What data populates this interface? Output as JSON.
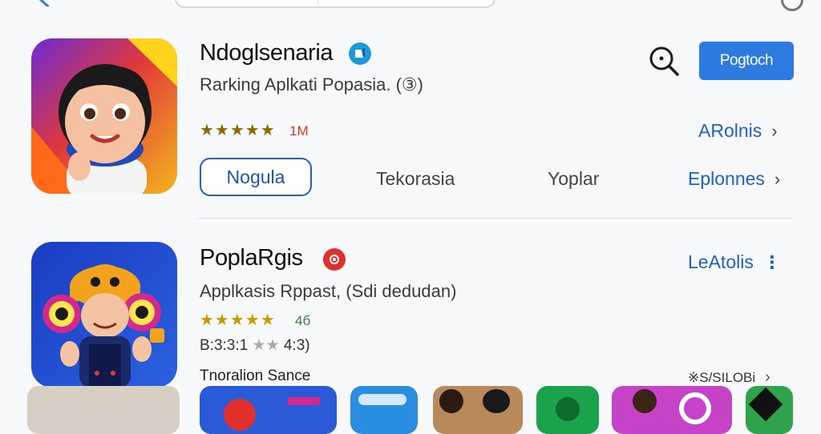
{
  "top_bar": {
    "back_icon": "chevron-left-icon",
    "search_icon": "search-icon"
  },
  "app1": {
    "title": "Ndoglsenaria",
    "subtitle": "Rarking Aplkati Popasia. (③)",
    "rating_stars": "★★★★★",
    "rating_count": "1M",
    "verified_icon": "verified-badge-icon",
    "get_button": "Pogtoch",
    "search_icon": "search-icon",
    "link": "ARolnis",
    "chips": [
      "Nogula",
      "Tekorasia",
      "Yoplar"
    ],
    "more_link": "Eplonnes"
  },
  "app2": {
    "title": "PoplaRgis",
    "subtitle": "Applkasis Rppast, (Sdi dedudan)",
    "rating_stars": "★★★★★",
    "rating_value": "4б",
    "rating_line2_label": "B:3:3:1",
    "rating_line2_stars": "★★",
    "rating_line2_value": "4:3)",
    "badge_icon": "award-badge-icon",
    "link": "LeAtolis",
    "more_icon": "more-vertical-icon"
  },
  "section": {
    "title": "Tnoralion Sance",
    "see_all": "※S/SILOBi"
  },
  "colors": {
    "accent": "#2d7be0",
    "link": "#1d63c6",
    "star": "#8a6a00",
    "count_red": "#d23a24"
  }
}
